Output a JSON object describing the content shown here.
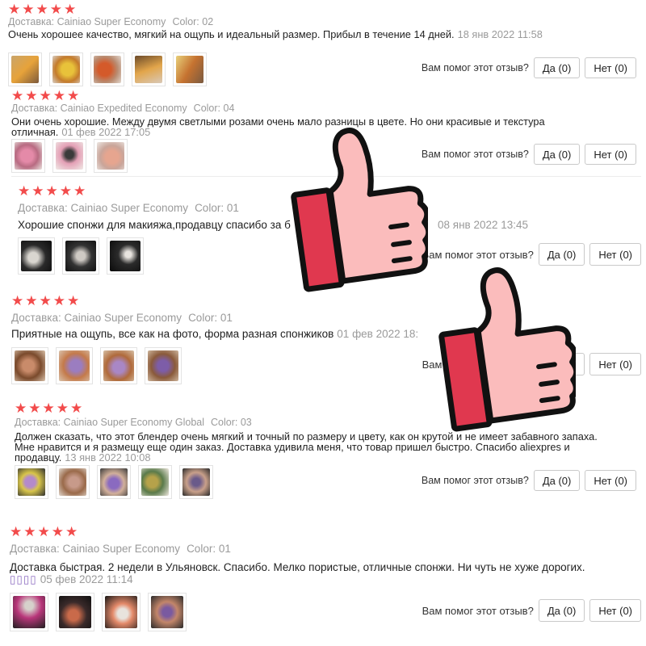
{
  "helpful_label": "Вам помог этот отзыв?",
  "yes_label": "Да (0)",
  "no_label": "Нет (0)",
  "rating_color": "#f24b4b",
  "reviews": [
    {
      "stars": 5,
      "shipping": "Доставка: Cainiao Super Economy",
      "color": "Color: 02",
      "text": "Очень хорошее качество, мягкий на ощупь и идеальный размер. Прибыл в течение 14 дней.",
      "date": "18 янв 2022 11:58",
      "photos": [
        "sponge-photo",
        "sponge-photo",
        "sponge-photo",
        "sponge-photo",
        "sponge-photo"
      ]
    },
    {
      "stars": 5,
      "shipping": "Доставка: Cainiao Expedited Economy",
      "color": "Color: 04",
      "text": "Они очень хорошие. Между двумя светлыми розами очень мало разницы в цвете. Но они красивые и текстура отличная.",
      "date": "01 фев 2022 17:05",
      "photos": [
        "sponge-photo",
        "sponge-photo",
        "sponge-photo"
      ]
    },
    {
      "stars": 5,
      "shipping": "Доставка: Cainiao Super Economy",
      "color": "Color: 01",
      "text": "Хорошие спонжи для макияжа,продавцу спасибо за б",
      "text_tail": "а.",
      "date": "08 янв 2022 13:45",
      "photos": [
        "sponge-photo",
        "sponge-photo",
        "sponge-photo"
      ]
    },
    {
      "stars": 5,
      "shipping": "Доставка: Cainiao Super Economy",
      "color": "Color: 01",
      "text": "Приятные на ощупь, все как на фото, форма разная спонжиков",
      "date": "01 фев 2022 18:",
      "photos": [
        "sponge-photo",
        "sponge-photo",
        "sponge-photo",
        "sponge-photo"
      ]
    },
    {
      "stars": 5,
      "shipping": "Доставка: Cainiao Super Economy Global",
      "color": "Color: 03",
      "text": "Должен сказать, что этот блендер очень мягкий и точный по размеру и цвету, как он крутой и не имеет забавного запаха. Мне нравится и я размещу еще один заказ. Доставка удивила меня, что товар пришел быстро. Спасибо aliexpres и продавцу.",
      "date": "13 янв 2022 10:08",
      "photos": [
        "sponge-photo",
        "sponge-photo",
        "sponge-photo",
        "sponge-photo",
        "sponge-photo"
      ]
    },
    {
      "stars": 5,
      "shipping": "Доставка: Cainiao Super Economy",
      "color": "Color: 01",
      "text": "Доставка быстрая. 2 недели в Ульяновск. Спасибо. Мелко пористые, отличные спонжи. Ни чуть не хуже дорогих.",
      "date": "05 фев 2022 11:14",
      "photos": [
        "sponge-photo",
        "sponge-photo",
        "sponge-photo",
        "sponge-photo"
      ]
    }
  ],
  "overlay_icons": [
    "thumbs-up-icon",
    "thumbs-up-icon"
  ]
}
